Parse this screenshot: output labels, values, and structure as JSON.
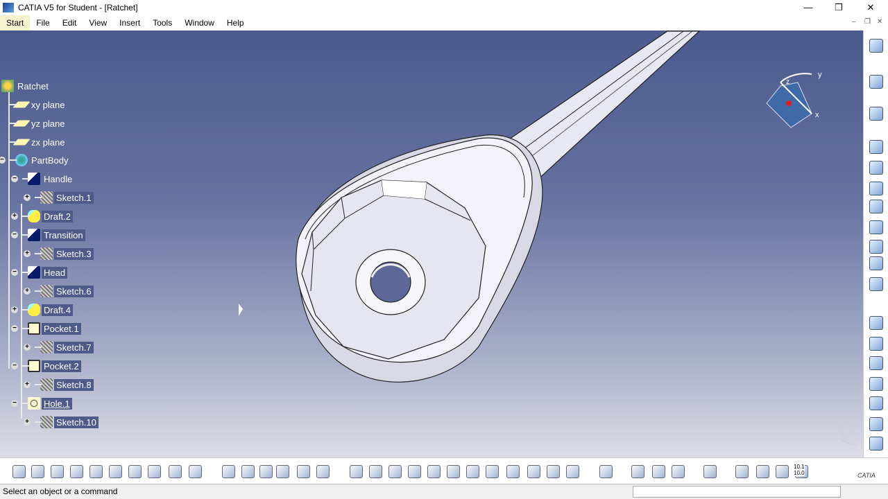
{
  "window": {
    "title": "CATIA V5 for Student - [Ratchet]",
    "controls": [
      "minimize",
      "restore",
      "close"
    ]
  },
  "menu": [
    "Start",
    "File",
    "Edit",
    "View",
    "Insert",
    "Tools",
    "Window",
    "Help"
  ],
  "tree": [
    {
      "label": "Ratchet",
      "icon": "part-icon",
      "depth": 0
    },
    {
      "label": "xy plane",
      "icon": "plane-icon",
      "depth": 1
    },
    {
      "label": "yz plane",
      "icon": "plane-icon",
      "depth": 1
    },
    {
      "label": "zx plane",
      "icon": "plane-icon",
      "depth": 1
    },
    {
      "label": "PartBody",
      "icon": "body-icon",
      "depth": 1,
      "toggle": "-"
    },
    {
      "label": "Handle",
      "icon": "pad-icon",
      "depth": 2,
      "toggle": "-"
    },
    {
      "label": "Sketch.1",
      "icon": "sketch-icon",
      "depth": 3,
      "toggle": "+",
      "selected": true
    },
    {
      "label": "Draft.2",
      "icon": "draft-icon",
      "depth": 2,
      "toggle": "+",
      "selected": true
    },
    {
      "label": "Transition",
      "icon": "pad-icon",
      "depth": 2,
      "toggle": "-",
      "selected": true
    },
    {
      "label": "Sketch.3",
      "icon": "sketch-icon",
      "depth": 3,
      "toggle": "+",
      "selected": true
    },
    {
      "label": "Head",
      "icon": "pad-icon",
      "depth": 2,
      "toggle": "-",
      "selected": true
    },
    {
      "label": "Sketch.6",
      "icon": "sketch-icon",
      "depth": 3,
      "toggle": "+",
      "selected": true
    },
    {
      "label": "Draft.4",
      "icon": "draft-icon",
      "depth": 2,
      "toggle": "+",
      "selected": true
    },
    {
      "label": "Pocket.1",
      "icon": "pocket-icon",
      "depth": 2,
      "toggle": "-",
      "selected": true
    },
    {
      "label": "Sketch.7",
      "icon": "sketch-icon",
      "depth": 3,
      "toggle": "+",
      "selected": true
    },
    {
      "label": "Pocket.2",
      "icon": "pocket-icon",
      "depth": 2,
      "toggle": "-",
      "selected": true
    },
    {
      "label": "Sketch.8",
      "icon": "sketch-icon",
      "depth": 3,
      "toggle": "+",
      "selected": true
    },
    {
      "label": "Hole.1",
      "icon": "hole-icon",
      "depth": 2,
      "toggle": "-",
      "selected": true,
      "underline": true
    },
    {
      "label": "Sketch.10",
      "icon": "sketch-icon",
      "depth": 3,
      "toggle": "+",
      "selected": true
    }
  ],
  "compass": {
    "labels": [
      "y",
      "z",
      "x"
    ]
  },
  "axis_labels": [
    "y",
    "z",
    "x"
  ],
  "bottom_toolbar": [
    "new-icon",
    "open-icon",
    "save-icon",
    "print-icon",
    "cut-icon",
    "copy-icon",
    "paste-icon",
    "undo-icon",
    "redo-icon",
    "whats-this-icon",
    "formula-icon",
    "comment-icon",
    "link-icon",
    "table-icon",
    "lock-icon",
    "parameters-icon",
    "fly-icon",
    "fit-all-icon",
    "pan-icon",
    "rotate-icon",
    "zoom-in-icon",
    "zoom-out-icon",
    "normal-view-icon",
    "multi-view-icon",
    "iso-view-icon",
    "render-style-icon",
    "hide-show-icon",
    "swap-view-icon",
    "measure-icon",
    "apply-material-icon",
    "mass-icon",
    "capture-icon",
    "sketch-analysis-icon",
    "manipulate-icon",
    "axis-icon",
    "units-icon",
    "catia-icon"
  ],
  "bottom_labels": {
    "units": "10.1\n10.0",
    "logo": "CATIA"
  },
  "right_toolbar": [
    "settings-icon",
    "select-icon",
    "sketcher-icon",
    "pad-icon",
    "pocket-icon",
    "shaft-icon",
    "groove-icon",
    "hole-icon",
    "rib-icon",
    "slot-icon",
    "stiffener-icon",
    "multi-sections-icon",
    "fillet-icon",
    "chamfer-icon",
    "draft-icon",
    "shell-icon",
    "thickness-icon",
    "thread-icon"
  ],
  "status": {
    "message": "Select an object or a command",
    "command_input": ""
  },
  "colors": {
    "selection": "#4e5a8a",
    "viewport_top": "#4b5a8e",
    "viewport_bottom": "#dddde6"
  }
}
